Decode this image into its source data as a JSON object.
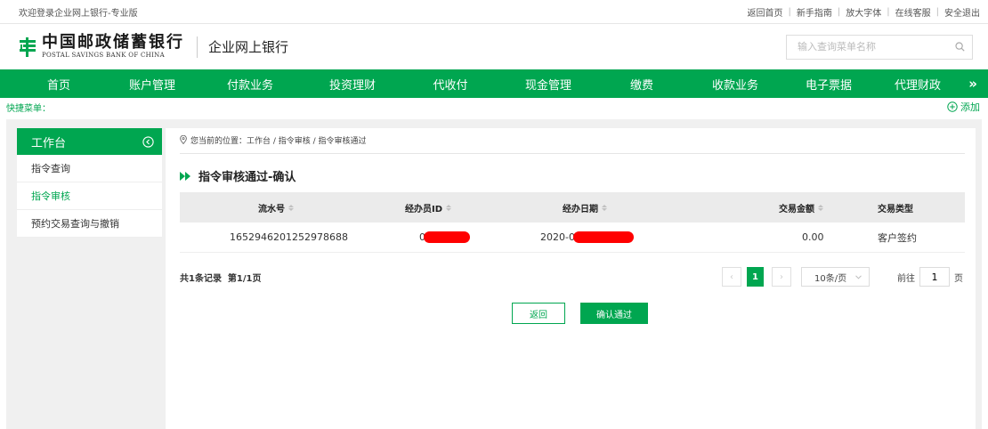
{
  "topbar": {
    "welcome": "欢迎登录企业网上银行-专业版",
    "links": [
      "返回首页",
      "新手指南",
      "放大字体",
      "在线客服",
      "安全退出"
    ]
  },
  "header": {
    "logo_cn": "中国邮政储蓄银行",
    "logo_en": "POSTAL SAVINGS BANK OF CHINA",
    "subtitle": "企业网上银行",
    "search_placeholder": "输入查询菜单名称",
    "search_icon": "search-icon"
  },
  "nav": {
    "items": [
      "首页",
      "账户管理",
      "付款业务",
      "投资理财",
      "代收付",
      "现金管理",
      "缴费",
      "收款业务",
      "电子票据",
      "代理财政"
    ],
    "more_label": "»"
  },
  "quick_menu": {
    "label": "快捷菜单：",
    "add_label": "添加"
  },
  "sidebar": {
    "title": "工作台",
    "items": [
      {
        "label": "指令查询",
        "active": false
      },
      {
        "label": "指令审核",
        "active": true
      },
      {
        "label": "预约交易查询与撤销",
        "active": false
      }
    ]
  },
  "breadcrumb": "您当前的位置：工作台 / 指令审核 / 指令审核通过",
  "section_title": "指令审核通过-确认",
  "table": {
    "headers": [
      "流水号",
      "经办员ID",
      "经办日期",
      "交易金额",
      "交易类型"
    ],
    "rows": [
      {
        "serial": "1652946201252978688",
        "operator_id": "0",
        "date": "2020-0",
        "amount": "0.00",
        "type": "客户签约"
      }
    ]
  },
  "pagination": {
    "summary": "共1条记录  第1/1页",
    "prev": "‹",
    "current": "1",
    "next": "›",
    "page_size": "10条/页",
    "goto_label": "前往",
    "goto_value": "1",
    "goto_suffix": "页"
  },
  "buttons": {
    "back": "返回",
    "confirm": "确认通过"
  },
  "colors": {
    "brand_green": "#00a650",
    "redaction": "#ff0000"
  }
}
